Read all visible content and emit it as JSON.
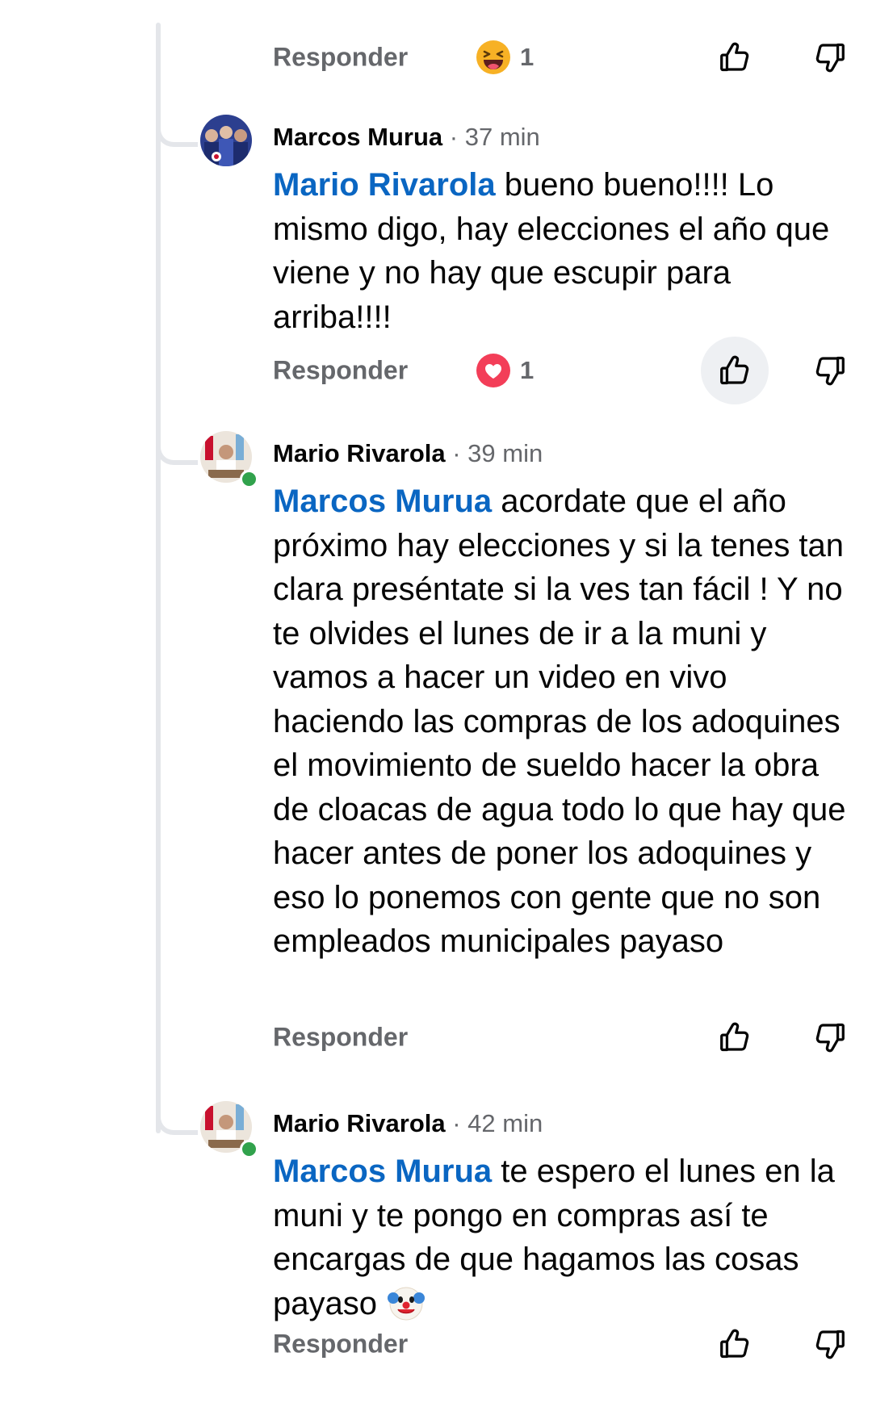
{
  "actions": {
    "reply_label": "Responder"
  },
  "top_actions": {
    "reaction": "haha",
    "reaction_count": "1"
  },
  "comments": [
    {
      "author": "Marcos Murua",
      "time": "· 37 min",
      "mention": "Mario Rivarola",
      "text": " bueno bueno!!!! Lo mismo digo, hay elecciones el año que viene y no hay que escupir para arriba!!!!",
      "reaction": "love",
      "reaction_count": "1",
      "liked": true
    },
    {
      "author": "Mario Rivarola",
      "time": "· 39 min",
      "mention": "Marcos Murua",
      "text": " acordate que el año próximo hay elecciones y si la tenes tan clara preséntate si la ves tan fácil ! Y no te olvides el lunes de ir a la muni y vamos a hacer un video en vivo haciendo las compras de los adoquines el movimiento de sueldo hacer la obra de cloacas de agua todo lo que hay que hacer antes de poner los adoquines y eso lo ponemos con gente que no son empleados municipales payaso",
      "online": true
    },
    {
      "author": "Mario Rivarola",
      "time": "· 42 min",
      "mention": "Marcos Murua",
      "text": " te espero el lunes en la muni y te pongo en compras así te encargas de que hagamos las cosas payaso",
      "emoji": "clown-face",
      "online": true
    }
  ],
  "colors": {
    "mention": "#0a66c2",
    "secondary_text": "#65676b",
    "online": "#31a24c",
    "love": "#f33e58",
    "haha": "#f7b125"
  }
}
